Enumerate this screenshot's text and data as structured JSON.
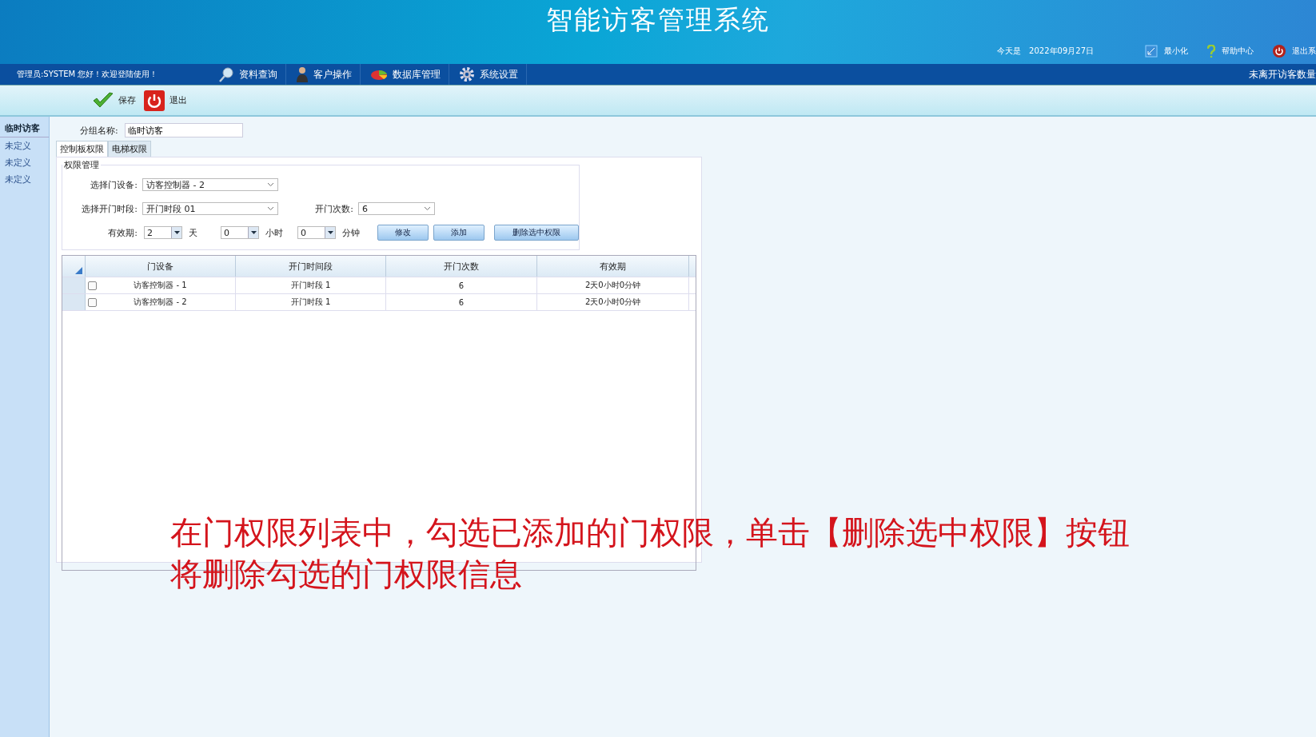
{
  "window": {
    "title": "智能访客管理系统"
  },
  "top_bar": {
    "date_label": "今天是",
    "date": "2022年09月27日",
    "actions": [
      {
        "label": "最小化",
        "kind": "minimize"
      },
      {
        "label": "帮助中心",
        "kind": "help"
      },
      {
        "label": "退出系",
        "kind": "exit"
      }
    ]
  },
  "nav": {
    "welcome": "管理员:SYSTEM 您好！欢迎登陆使用！",
    "items": [
      {
        "label": "资料查询",
        "kind": "search"
      },
      {
        "label": "客户操作",
        "kind": "user"
      },
      {
        "label": "数据库管理",
        "kind": "db"
      },
      {
        "label": "系统设置",
        "kind": "gear"
      }
    ],
    "ticker": "未离开访客数量"
  },
  "toolbar": [
    {
      "label": "保存",
      "kind": "save"
    },
    {
      "label": "退出",
      "kind": "exit"
    }
  ],
  "sidebar": {
    "items": [
      {
        "label": "临时访客",
        "selected": true
      },
      {
        "label": "未定义",
        "selected": false
      },
      {
        "label": "未定义",
        "selected": false
      },
      {
        "label": "未定义",
        "selected": false
      }
    ]
  },
  "group_name": {
    "label": "分组名称:",
    "value": "临时访客"
  },
  "tabs": [
    {
      "label": "控制板权限",
      "selected": true
    },
    {
      "label": "电梯权限",
      "selected": false
    }
  ],
  "permissions": {
    "legend": "权限管理",
    "door_label": "选择门设备:",
    "door_value": "访客控制器 - 2",
    "period_label": "选择开门时段:",
    "period_value": "开门时段 01",
    "count_label": "开门次数:",
    "count_value": "6",
    "valid_label": "有效期:",
    "days": "2",
    "days_unit": "天",
    "hours": "0",
    "hours_unit": "小时",
    "minutes": "0",
    "minutes_unit": "分钟",
    "buttons": [
      "修改",
      "添加",
      "删除选中权限"
    ]
  },
  "table": {
    "columns": [
      "门设备",
      "开门时间段",
      "开门次数",
      "有效期"
    ],
    "rows": [
      {
        "checked": false,
        "cells": [
          "访客控制器 - 1",
          "开门时段 1",
          "6",
          "2天0小时0分钟"
        ]
      },
      {
        "checked": false,
        "cells": [
          "访客控制器 - 2",
          "开门时段 1",
          "6",
          "2天0小时0分钟"
        ]
      }
    ]
  },
  "caption": "在门权限列表中，勾选已添加的门权限，单击【删除选中权限】按钮将删除勾选的门权限信息"
}
